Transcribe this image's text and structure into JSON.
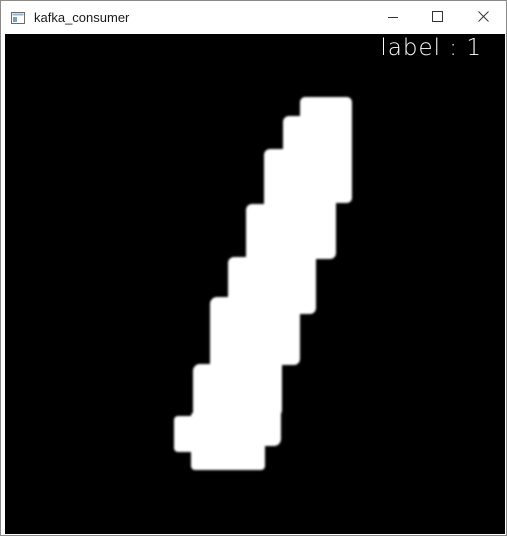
{
  "window": {
    "title": "kafka_consumer",
    "icons": {
      "app": "window-app-icon",
      "minimize": "minimize-icon",
      "maximize": "maximize-icon",
      "close": "close-icon"
    }
  },
  "display": {
    "label_text": "label : 1",
    "label_value": 1,
    "background_color": "#000000",
    "digit_color": "#ffffff"
  }
}
